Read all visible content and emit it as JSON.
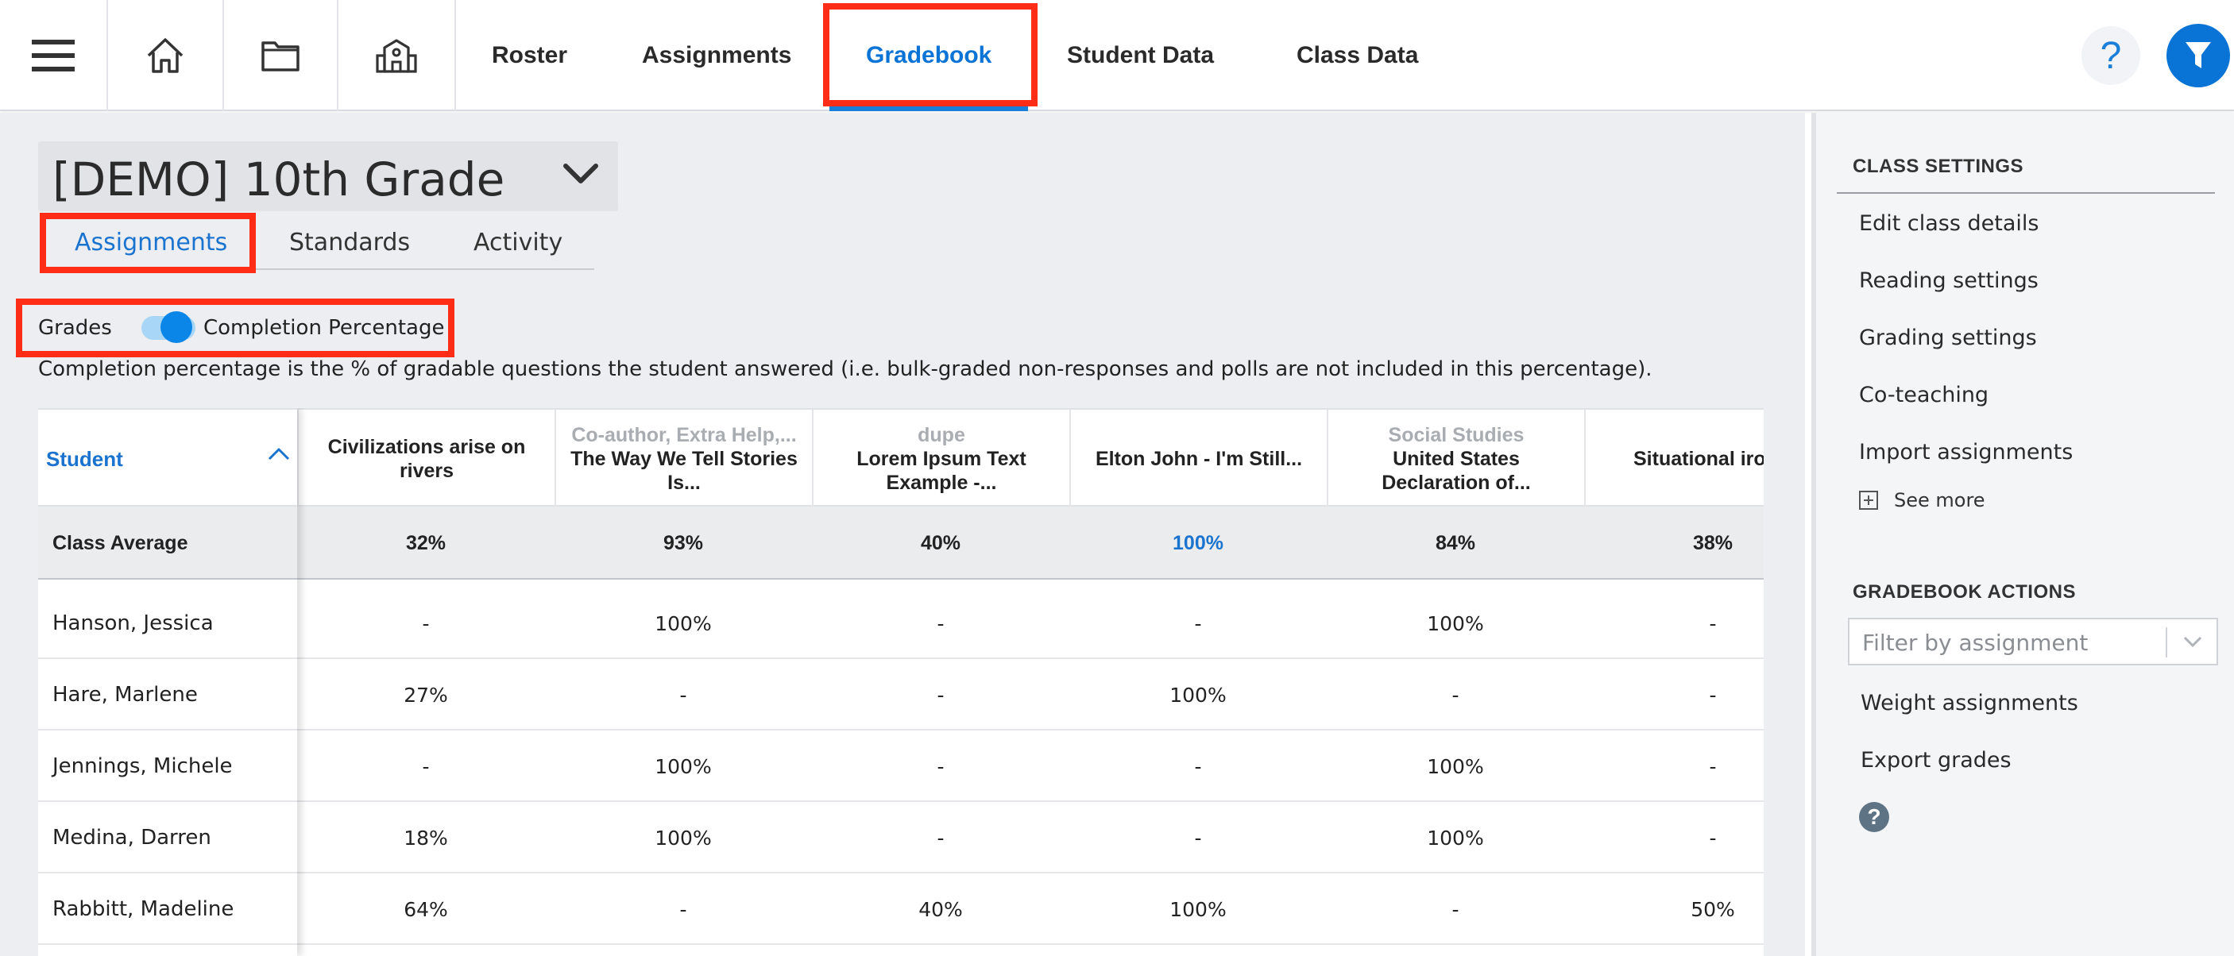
{
  "nav": {
    "icons": [
      "menu-icon",
      "home-icon",
      "folder-icon",
      "school-icon"
    ],
    "links": [
      "Roster",
      "Assignments",
      "Gradebook",
      "Student Data",
      "Class Data"
    ],
    "active": "Gradebook",
    "help_label": "?",
    "accent_color": "#0a74d6",
    "highlight_color": "#ff2d16"
  },
  "class_selector": {
    "title": "[DEMO] 10th Grade"
  },
  "subtabs": {
    "assignments": "Assignments",
    "standards": "Standards",
    "activity": "Activity",
    "active": "Assignments"
  },
  "toggle": {
    "left_label": "Grades",
    "right_label": "Completion Percentage",
    "state": "Completion Percentage"
  },
  "description": "Completion percentage is the % of gradable questions the student answered (i.e. bulk-graded non-responses and polls are not included in this percentage).",
  "table": {
    "student_header": "Student",
    "average_label": "Class Average",
    "columns": [
      {
        "category": "",
        "name": "Civilizations arise on rivers"
      },
      {
        "category": "Co-author, Extra Help,...",
        "name": "The Way We Tell Stories Is..."
      },
      {
        "category": "dupe",
        "name": "Lorem Ipsum Text Example -..."
      },
      {
        "category": "",
        "name": "Elton John - I'm Still..."
      },
      {
        "category": "Social Studies",
        "name": "United States Declaration of..."
      },
      {
        "category": "",
        "name": "Situational iro The..."
      }
    ],
    "averages": [
      "32%",
      "93%",
      "40%",
      "100%",
      "84%",
      "38%"
    ],
    "rows": [
      {
        "name": "Hanson, Jessica",
        "values": [
          "-",
          "100%",
          "-",
          "-",
          "100%",
          "-"
        ]
      },
      {
        "name": "Hare, Marlene",
        "values": [
          "27%",
          "-",
          "-",
          "100%",
          "-",
          "-"
        ]
      },
      {
        "name": "Jennings, Michele",
        "values": [
          "-",
          "100%",
          "-",
          "-",
          "100%",
          "-"
        ]
      },
      {
        "name": "Medina, Darren",
        "values": [
          "18%",
          "100%",
          "-",
          "-",
          "100%",
          "-"
        ]
      },
      {
        "name": "Rabbitt, Madeline",
        "values": [
          "64%",
          "-",
          "40%",
          "100%",
          "-",
          "50%"
        ]
      }
    ]
  },
  "sidebar": {
    "class_settings_title": "CLASS SETTINGS",
    "class_settings": [
      "Edit class details",
      "Reading settings",
      "Grading settings",
      "Co-teaching",
      "Import assignments"
    ],
    "see_more": "See more",
    "gradebook_actions_title": "GRADEBOOK ACTIONS",
    "filter_placeholder": "Filter by assignment",
    "actions": [
      "Weight assignments",
      "Export grades"
    ],
    "help_label": "?"
  }
}
